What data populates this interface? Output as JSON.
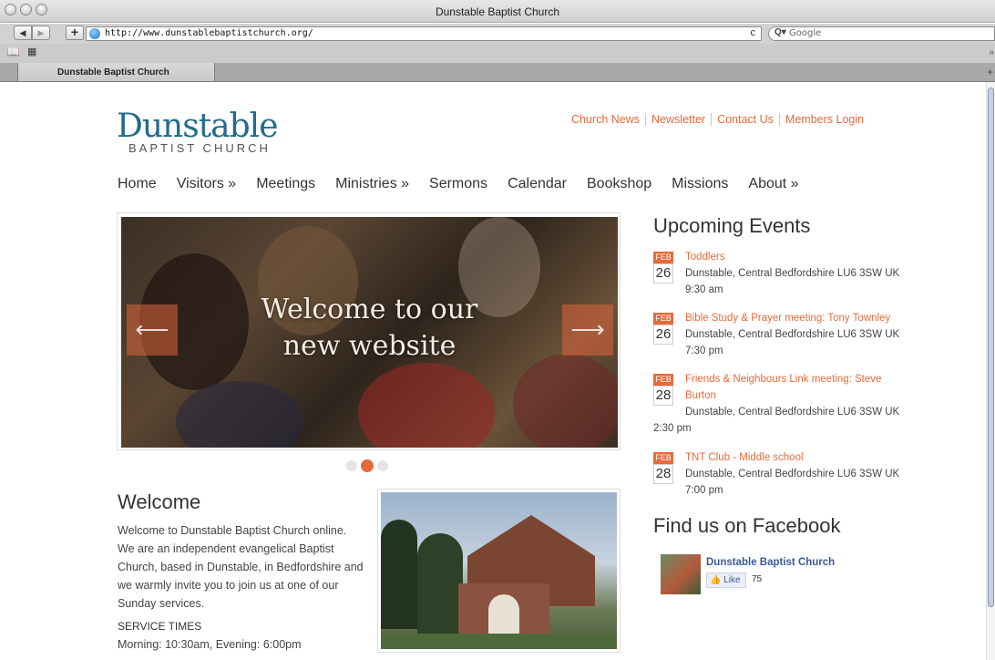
{
  "window": {
    "title": "Dunstable Baptist Church"
  },
  "toolbar": {
    "back_icon": "◀",
    "forward_icon": "▶",
    "newtab_icon": "+",
    "url": "http://www.dunstablebaptistchurch.org/",
    "reload_icon": "c",
    "search_icon": "Q▾",
    "search_placeholder": "Google"
  },
  "bookmarks": {
    "book_icon": "📖",
    "grid_icon": "▦",
    "more_icon": "»"
  },
  "tabs": [
    {
      "label": "Dunstable Baptist Church"
    }
  ],
  "tab_add_icon": "+",
  "site": {
    "logo": {
      "main": "Dunstable",
      "sub": "BAPTIST CHURCH"
    },
    "top_links": [
      "Church News",
      "Newsletter",
      "Contact Us",
      "Members Login"
    ],
    "nav": [
      "Home",
      "Visitors »",
      "Meetings",
      "Ministries »",
      "Sermons",
      "Calendar",
      "Bookshop",
      "Missions",
      "About »"
    ],
    "slider": {
      "line1": "Welcome to our",
      "line2": "new website",
      "prev_icon": "⟵",
      "next_icon": "⟶",
      "active_slide": 2,
      "slide_count": 3
    },
    "welcome": {
      "heading": "Welcome",
      "text": "Welcome to Dunstable Baptist Church online. We are an independent evangelical Baptist Church, based in Dunstable, in Bedfordshire and we warmly invite you to join us at one of our Sunday services.",
      "service_heading": "SERVICE TIMES",
      "service_text": "Morning: 10:30am, Evening: 6:00pm"
    },
    "events": {
      "heading": "Upcoming Events",
      "items": [
        {
          "month": "FEB",
          "day": "26",
          "title": "Toddlers",
          "location": "Dunstable, Central Bedfordshire LU6 3SW UK",
          "time": "9:30 am"
        },
        {
          "month": "FEB",
          "day": "26",
          "title": "Bible Study & Prayer meeting: Tony Townley",
          "location": "Dunstable, Central Bedfordshire LU6 3SW UK",
          "time": "7:30 pm"
        },
        {
          "month": "FEB",
          "day": "28",
          "title": "Friends & Neighbours Link meeting: Steve Burton",
          "location": "Dunstable, Central Bedfordshire LU6 3SW UK",
          "time": "2:30 pm"
        },
        {
          "month": "FEB",
          "day": "28",
          "title": "TNT Club - Middle school",
          "location": "Dunstable, Central Bedfordshire LU6 3SW UK",
          "time": "7:00 pm"
        }
      ]
    },
    "facebook": {
      "heading": "Find us on Facebook",
      "page_name": "Dunstable Baptist Church",
      "like_label": "Like",
      "like_icon": "👍",
      "like_count": "75"
    },
    "colors": {
      "accent": "#e86a3a",
      "logo": "#1f6c8c",
      "facebook": "#3b5998"
    }
  }
}
